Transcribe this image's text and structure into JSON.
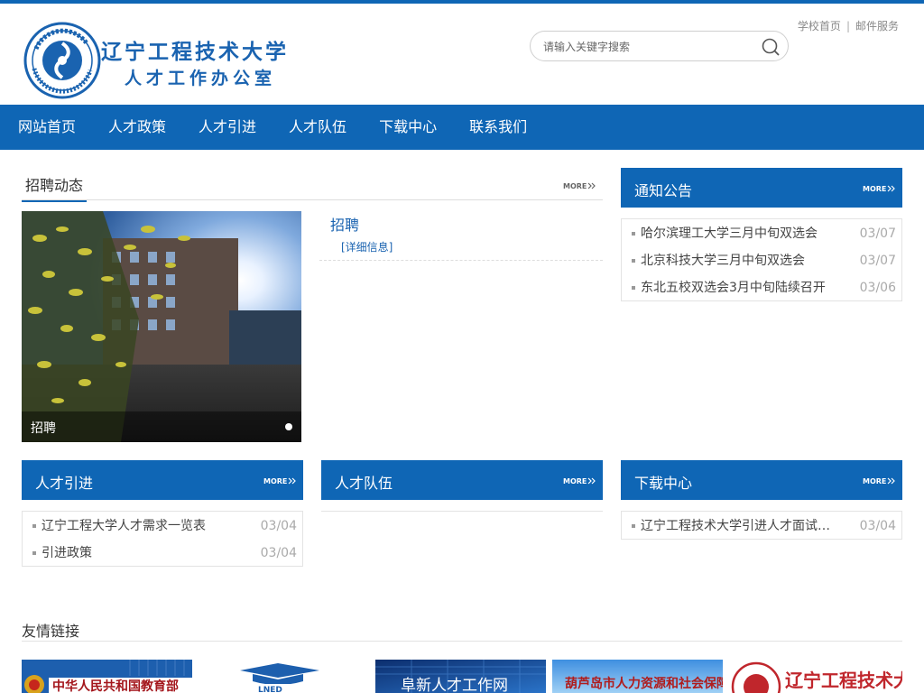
{
  "header": {
    "school_name": "辽宁工程技术大学",
    "office_name": "人才工作办公室",
    "logo_text": "辽宁工程技术大学 L.N TECHNICAL UNIVERSITY",
    "top_links": [
      "学校首页",
      "邮件服务"
    ],
    "search_placeholder": "请输入关键字搜索"
  },
  "nav": [
    "网站首页",
    "人才政策",
    "人才引进",
    "人才队伍",
    "下载中心",
    "联系我们"
  ],
  "recruit": {
    "title": "招聘动态",
    "more": "MORE",
    "slide_caption": "招聘",
    "news_title": "招聘",
    "news_detail": "[详细信息]"
  },
  "notice": {
    "title": "通知公告",
    "more": "MORE",
    "items": [
      {
        "text": "哈尔滨理工大学三月中旬双选会",
        "date": "03/07"
      },
      {
        "text": "北京科技大学三月中旬双选会",
        "date": "03/07"
      },
      {
        "text": "东北五校双选会3月中旬陆续召开",
        "date": "03/06"
      }
    ]
  },
  "talent_intro": {
    "title": "人才引进",
    "more": "MORE",
    "items": [
      {
        "text": "辽宁工程大学人才需求一览表",
        "date": "03/04"
      },
      {
        "text": "引进政策",
        "date": "03/04"
      }
    ]
  },
  "talent_team": {
    "title": "人才队伍",
    "more": "MORE"
  },
  "downloads": {
    "title": "下载中心",
    "more": "MORE",
    "items": [
      {
        "text": "辽宁工程技术大学引进人才面试考…",
        "date": "03/04"
      }
    ]
  },
  "friends": {
    "title": "友情链接",
    "banners": [
      "中华人民共和国教育部",
      "LNED",
      "阜新人才工作网",
      "葫芦岛市人力资源和社会保障局",
      "辽宁工程技术大学"
    ]
  },
  "colors": {
    "primary": "#0f66b5",
    "text": "#333333",
    "date": "#aaaaaa"
  }
}
